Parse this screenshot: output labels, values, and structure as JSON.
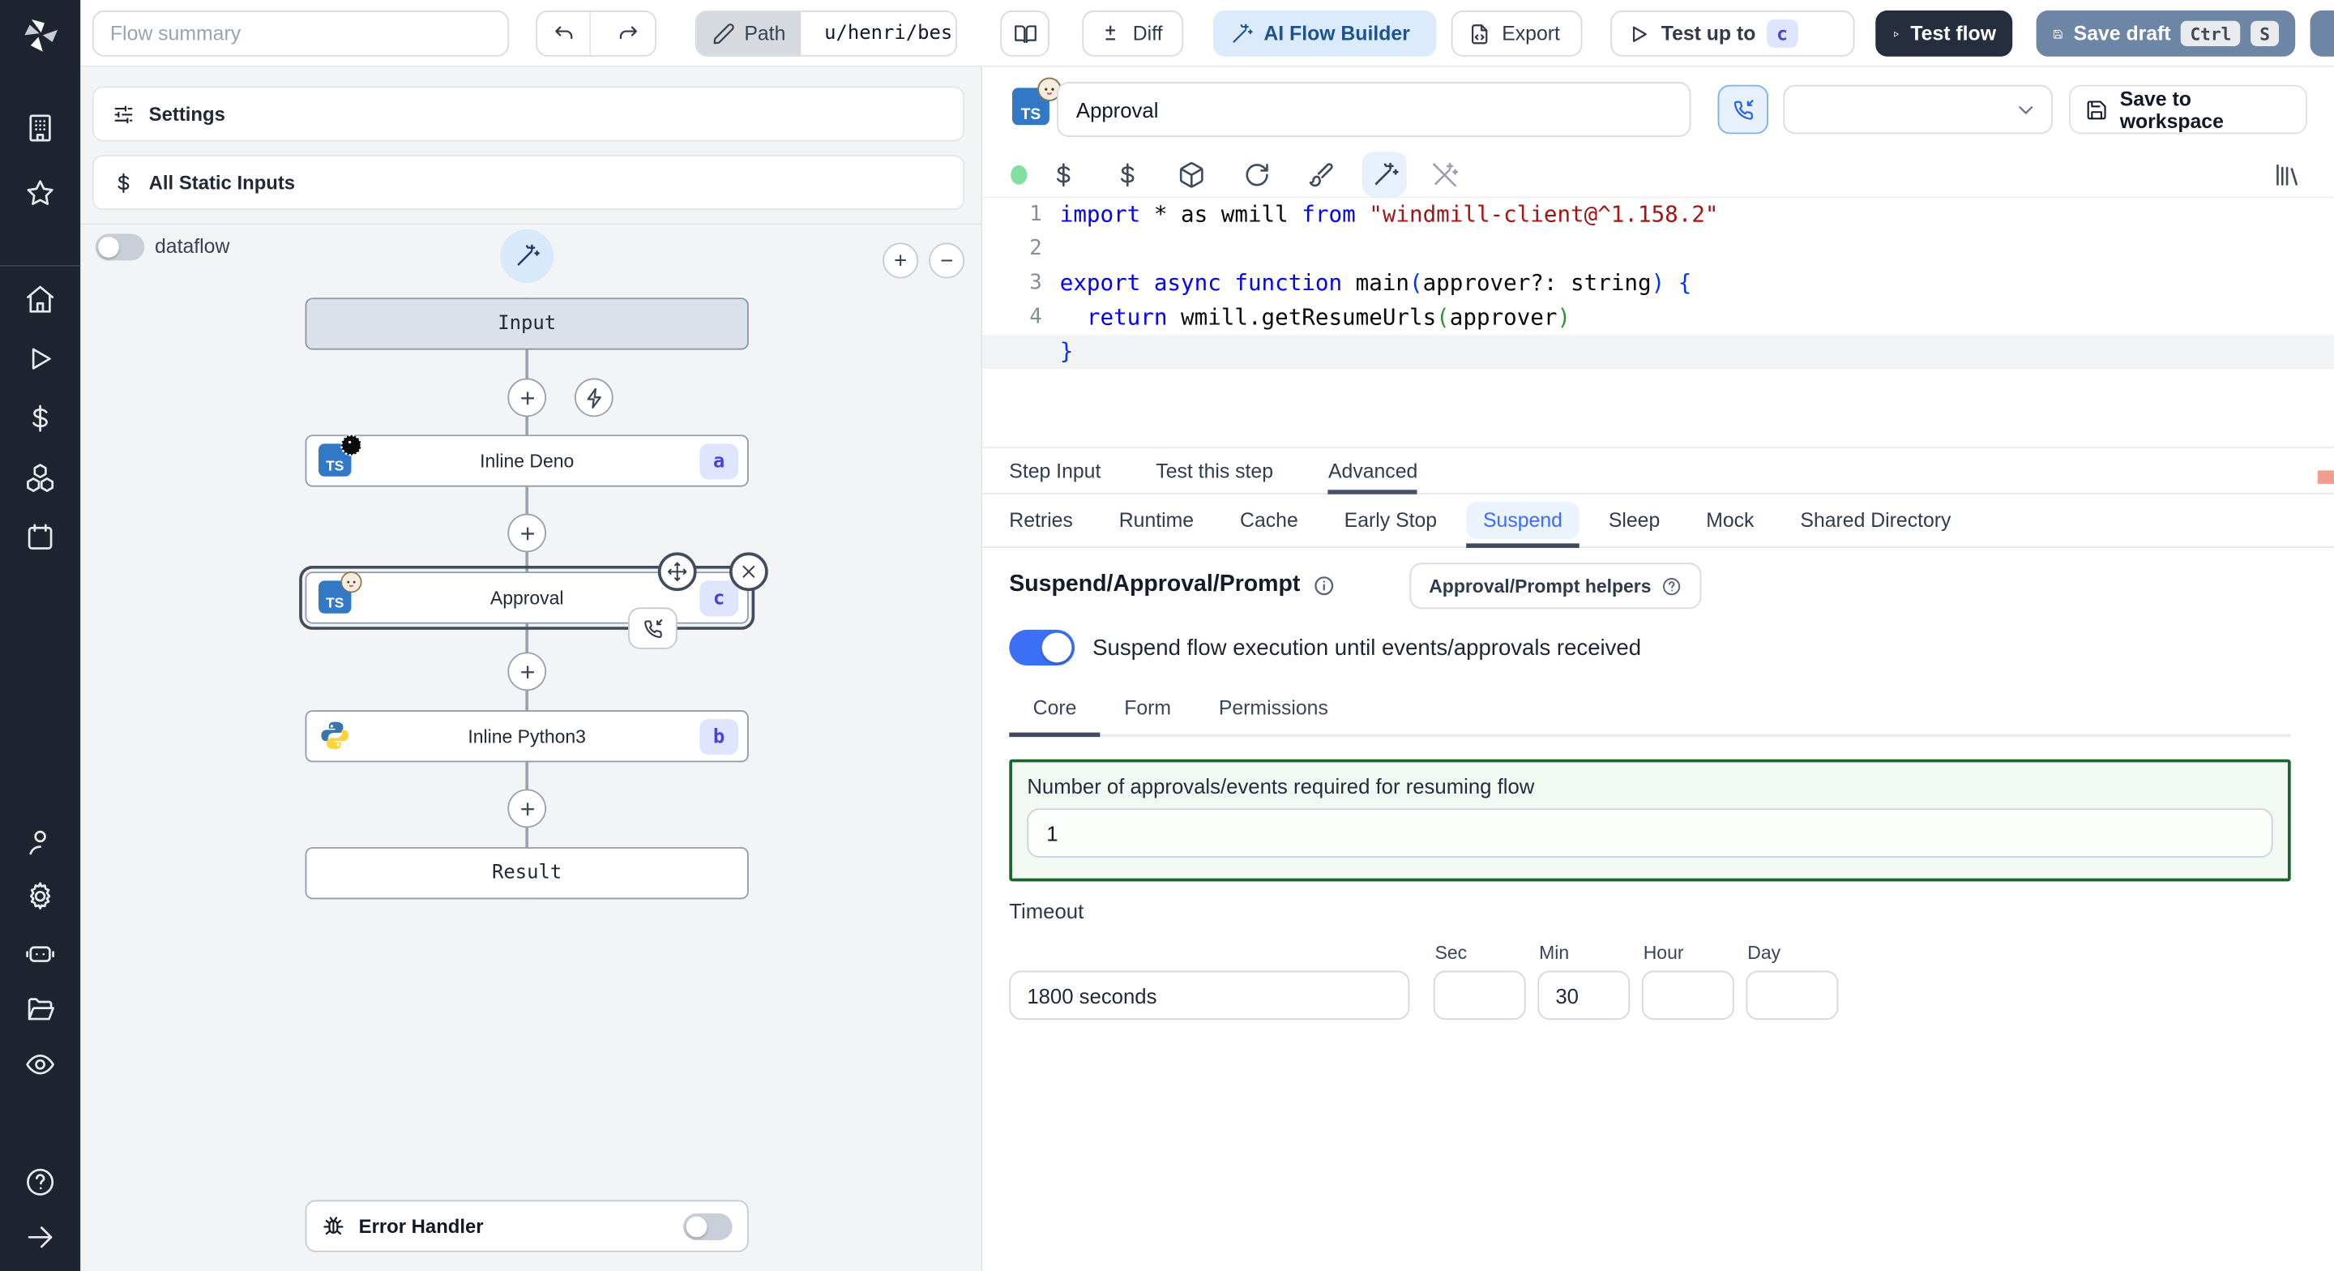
{
  "topbar": {
    "flow_summary_placeholder": "Flow summary",
    "path_label": "Path",
    "path_value": "u/henri/bes",
    "diff_label": "Diff",
    "ai_flow_builder_label": "AI Flow Builder",
    "export_label": "Export",
    "test_up_to_label": "Test up to",
    "test_up_to_badge": "c",
    "test_flow_label": "Test flow",
    "save_draft_label": "Save draft",
    "kbd_ctrl": "Ctrl",
    "kbd_s": "S"
  },
  "sidebar_icons": [
    "windmill-logo",
    "workspace-building",
    "favorites-star",
    "home",
    "runs-play",
    "variables-dollar",
    "resources-boxes",
    "schedules-calendar",
    "users-person",
    "settings-gear",
    "workers-robot",
    "folders",
    "audit-logs-eye",
    "help",
    "collapse-arrow"
  ],
  "left": {
    "settings_label": "Settings",
    "all_static_inputs_label": "All Static Inputs",
    "dataflow_label": "dataflow",
    "error_handler_label": "Error Handler"
  },
  "graph": {
    "input_label": "Input",
    "result_label": "Result",
    "nodes": [
      {
        "label": "Inline Deno",
        "badge": "a"
      },
      {
        "label": "Approval",
        "badge": "c"
      },
      {
        "label": "Inline Python3",
        "badge": "b"
      }
    ]
  },
  "editor": {
    "step_name": "Approval",
    "save_to_workspace_label": "Save to workspace",
    "code": {
      "current_line": 5,
      "lines": [
        [
          {
            "t": "import",
            "c": "kw"
          },
          {
            "t": " * as wmill ",
            "c": "pl"
          },
          {
            "t": "from",
            "c": "kw"
          },
          {
            "t": " ",
            "c": "pl"
          },
          {
            "t": "\"windmill-client@^1.158.2\"",
            "c": "str"
          }
        ],
        [],
        [
          {
            "t": "export",
            "c": "kw"
          },
          {
            "t": " ",
            "c": "pl"
          },
          {
            "t": "async",
            "c": "kw"
          },
          {
            "t": " ",
            "c": "pl"
          },
          {
            "t": "function",
            "c": "kw"
          },
          {
            "t": " main",
            "c": "pl"
          },
          {
            "t": "(",
            "c": "b1"
          },
          {
            "t": "approver?: string",
            "c": "pl"
          },
          {
            "t": ")",
            "c": "b1"
          },
          {
            "t": " ",
            "c": "pl"
          },
          {
            "t": "{",
            "c": "b1"
          }
        ],
        [
          {
            "t": "  ",
            "c": "pl"
          },
          {
            "t": "return",
            "c": "kw"
          },
          {
            "t": " wmill.getResumeUrls",
            "c": "pl"
          },
          {
            "t": "(",
            "c": "b2"
          },
          {
            "t": "approver",
            "c": "pl"
          },
          {
            "t": ")",
            "c": "b2"
          }
        ],
        [
          {
            "t": "}",
            "c": "b1"
          }
        ]
      ]
    }
  },
  "tabs": {
    "main": [
      "Step Input",
      "Test this step",
      "Advanced"
    ],
    "main_selected": "Advanced",
    "advanced": [
      "Retries",
      "Runtime",
      "Cache",
      "Early Stop",
      "Suspend",
      "Sleep",
      "Mock",
      "Shared Directory"
    ],
    "advanced_selected": "Suspend"
  },
  "suspend": {
    "title": "Suspend/Approval/Prompt",
    "helpers_label": "Approval/Prompt helpers",
    "toggle_label": "Suspend flow execution until events/approvals received",
    "toggle_on": true,
    "subtabs": [
      "Core",
      "Form",
      "Permissions"
    ],
    "subtab_selected": "Core",
    "approvals_label": "Number of approvals/events required for resuming flow",
    "approvals_value": "1",
    "timeout_label": "Timeout",
    "timeout_value": "1800 seconds",
    "units": [
      "Sec",
      "Min",
      "Hour",
      "Day"
    ],
    "min_value": "30"
  },
  "colors": {
    "accent_blue": "#3b6ff6",
    "suspend_tab_blue": "#3f6af2",
    "badge_bg": "#dfe5fc",
    "badge_text": "#4a44d6",
    "green_border": "#18652f",
    "save_draft_bg": "#6d86a5",
    "test_flow_bg": "#262d3e",
    "sidebar_bg": "#1f2530"
  }
}
